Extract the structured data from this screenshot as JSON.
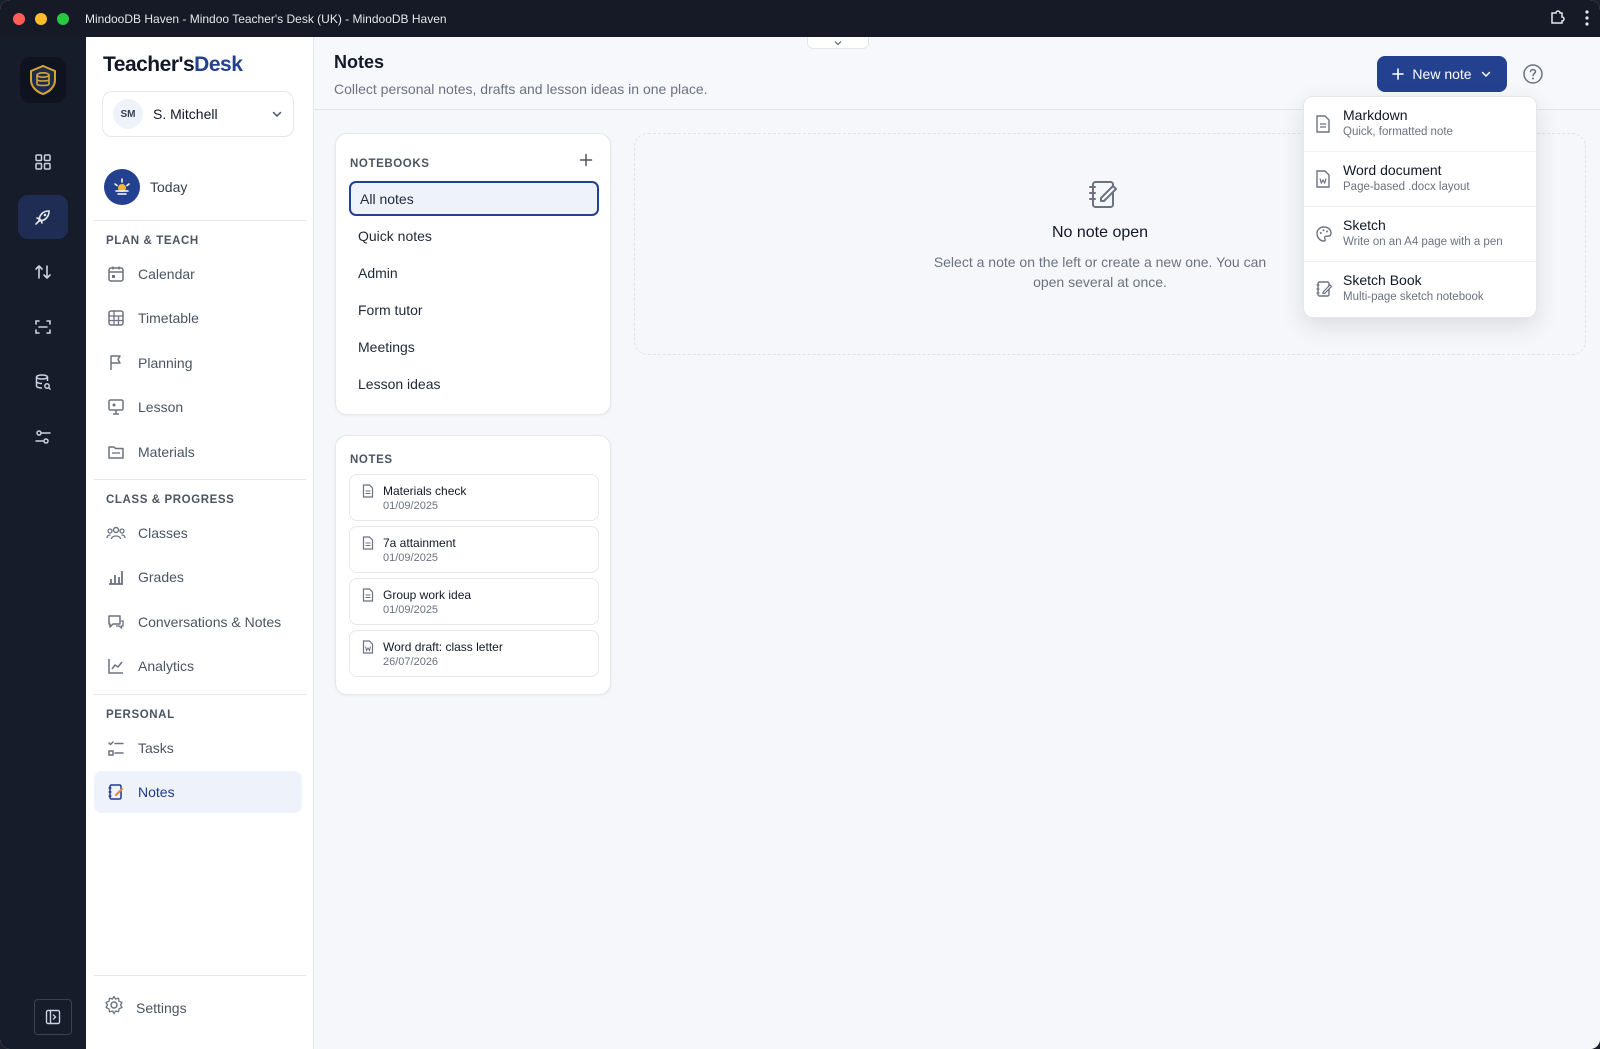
{
  "window": {
    "title": "MindooDB Haven - Mindoo Teacher's Desk (UK) - MindooDB Haven"
  },
  "brand": {
    "part1": "Teacher's",
    "part2": "Desk"
  },
  "user": {
    "initials": "SM",
    "name": "S. Mitchell"
  },
  "today": {
    "label": "Today"
  },
  "sections": {
    "plan": "PLAN & TEACH",
    "class": "CLASS & PROGRESS",
    "personal": "PERSONAL"
  },
  "nav": {
    "calendar": "Calendar",
    "timetable": "Timetable",
    "planning": "Planning",
    "lesson": "Lesson",
    "materials": "Materials",
    "classes": "Classes",
    "grades": "Grades",
    "conversations": "Conversations & Notes",
    "analytics": "Analytics",
    "tasks": "Tasks",
    "notes": "Notes",
    "settings": "Settings"
  },
  "page": {
    "title": "Notes",
    "subtitle": "Collect personal notes, drafts and lesson ideas in one place.",
    "new_note_label": "New note"
  },
  "notebooks": {
    "title": "NOTEBOOKS",
    "items": [
      "All notes",
      "Quick notes",
      "Admin",
      "Form tutor",
      "Meetings",
      "Lesson ideas"
    ],
    "selected": "All notes"
  },
  "notes": {
    "title": "NOTES",
    "items": [
      {
        "title": "Materials check",
        "date": "01/09/2025"
      },
      {
        "title": "7a attainment",
        "date": "01/09/2025"
      },
      {
        "title": "Group work idea",
        "date": "01/09/2025"
      },
      {
        "title": "Word draft: class letter",
        "date": "26/07/2026"
      }
    ]
  },
  "empty": {
    "title": "No note open",
    "description": "Select a note on the left or create a new one. You can open several at once."
  },
  "new_note_menu": [
    {
      "title": "Markdown",
      "subtitle": "Quick, formatted note",
      "icon": "markdown-file-icon"
    },
    {
      "title": "Word document",
      "subtitle": "Page-based .docx layout",
      "icon": "word-file-icon"
    },
    {
      "title": "Sketch",
      "subtitle": "Write on an A4 page with a pen",
      "icon": "palette-icon"
    },
    {
      "title": "Sketch Book",
      "subtitle": "Multi-page sketch notebook",
      "icon": "sketchbook-icon"
    }
  ],
  "colors": {
    "accent": "#23418f",
    "rail": "#171c2b",
    "titlebar": "#161a26"
  }
}
